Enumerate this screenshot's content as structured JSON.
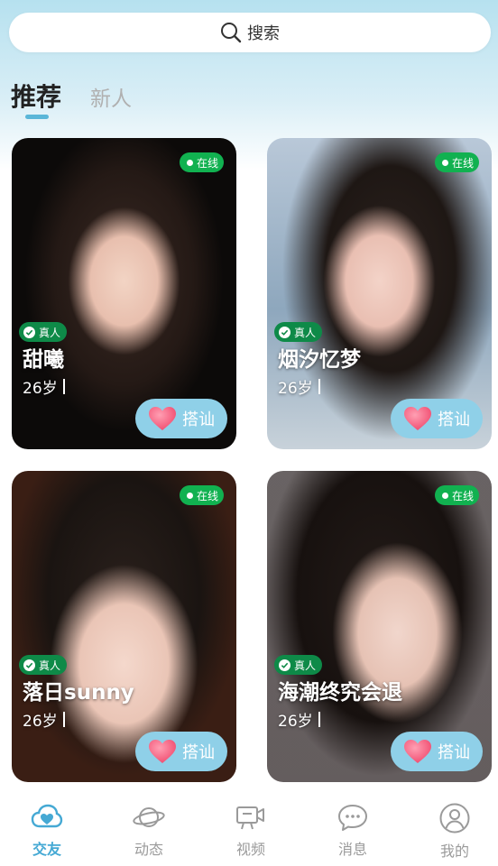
{
  "search": {
    "label": "搜索"
  },
  "tabs": [
    {
      "label": "推荐",
      "active": true
    },
    {
      "label": "新人",
      "active": false
    }
  ],
  "colors": {
    "accent": "#45a9d4",
    "online": "#11b150",
    "chat_button": "#8fd0e8"
  },
  "cards": [
    {
      "status": "在线",
      "badge": "真人",
      "name": "甜曦",
      "age": "26岁",
      "action": "搭讪"
    },
    {
      "status": "在线",
      "badge": "真人",
      "name": "烟汐忆梦",
      "age": "26岁",
      "action": "搭讪"
    },
    {
      "status": "在线",
      "badge": "真人",
      "name": "落日sunny",
      "age": "26岁",
      "action": "搭讪"
    },
    {
      "status": "在线",
      "badge": "真人",
      "name": "海潮终究会退",
      "age": "26岁",
      "action": "搭讪"
    }
  ],
  "nav": [
    {
      "label": "交友",
      "icon": "friends-icon",
      "active": true
    },
    {
      "label": "动态",
      "icon": "planet-icon",
      "active": false
    },
    {
      "label": "视频",
      "icon": "video-icon",
      "active": false
    },
    {
      "label": "消息",
      "icon": "message-icon",
      "active": false
    },
    {
      "label": "我的",
      "icon": "profile-icon",
      "active": false
    }
  ]
}
